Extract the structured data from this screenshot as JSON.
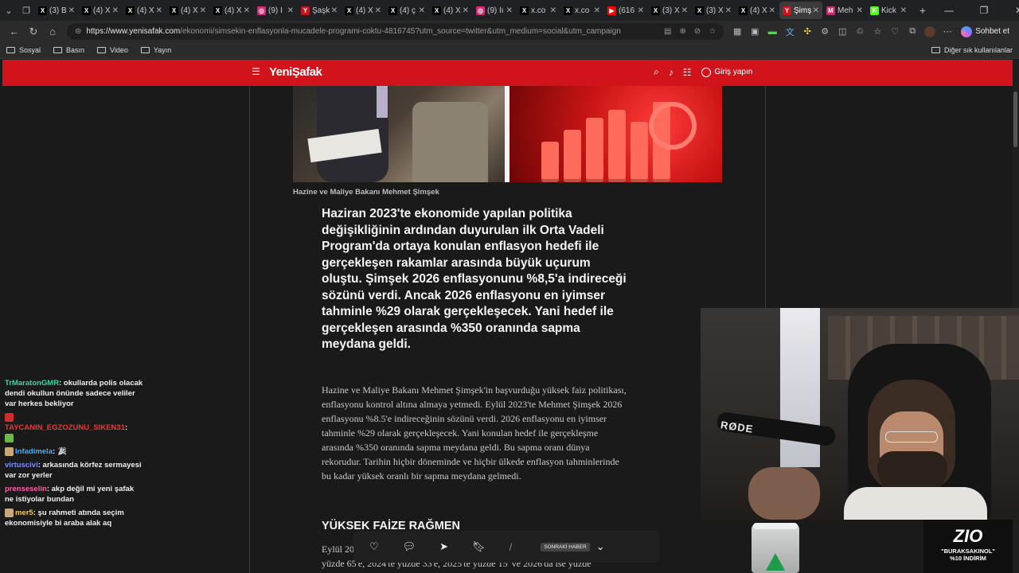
{
  "tabs": [
    {
      "icon": "x-logo-icon",
      "title": "(3) B",
      "fav_color": "#000000",
      "fav_text": "X"
    },
    {
      "icon": "x-logo-icon",
      "title": "(4) X",
      "fav_color": "#000000",
      "fav_text": "X"
    },
    {
      "icon": "x-logo-icon",
      "title": "(4) X",
      "fav_color": "#000000",
      "fav_text": "X"
    },
    {
      "icon": "x-logo-icon",
      "title": "(4) X",
      "fav_color": "#000000",
      "fav_text": "X"
    },
    {
      "icon": "x-logo-icon",
      "title": "(4) X",
      "fav_color": "#000000",
      "fav_text": "X"
    },
    {
      "icon": "instagram-icon",
      "title": "(9) İ",
      "fav_color": "#d62976",
      "fav_text": "◎"
    },
    {
      "icon": "site-icon",
      "title": "Şaşk",
      "fav_color": "#c4161c",
      "fav_text": "Y"
    },
    {
      "icon": "x-logo-icon",
      "title": "(4) X",
      "fav_color": "#000000",
      "fav_text": "X"
    },
    {
      "icon": "x-logo-icon",
      "title": "(4) ç",
      "fav_color": "#000000",
      "fav_text": "X"
    },
    {
      "icon": "x-logo-icon",
      "title": "(4) X",
      "fav_color": "#000000",
      "fav_text": "X"
    },
    {
      "icon": "instagram-icon",
      "title": "(9) İı",
      "fav_color": "#d62976",
      "fav_text": "◎"
    },
    {
      "icon": "x-logo-icon",
      "title": "x.co",
      "fav_color": "#000000",
      "fav_text": "X"
    },
    {
      "icon": "x-logo-icon",
      "title": "x.co",
      "fav_color": "#000000",
      "fav_text": "X"
    },
    {
      "icon": "youtube-icon",
      "title": "(616",
      "fav_color": "#ff0000",
      "fav_text": "▶"
    },
    {
      "icon": "x-logo-icon",
      "title": "(3) X",
      "fav_color": "#000000",
      "fav_text": "X"
    },
    {
      "icon": "x-logo-icon",
      "title": "(3) X",
      "fav_color": "#000000",
      "fav_text": "X"
    },
    {
      "icon": "x-logo-icon",
      "title": "(4) X",
      "fav_color": "#000000",
      "fav_text": "X"
    },
    {
      "icon": "yenisafak-icon",
      "title": "Şimş",
      "fav_color": "#d1141c",
      "fav_text": "Y",
      "active": true
    },
    {
      "icon": "site-icon",
      "title": "Meh",
      "fav_color": "#c0306a",
      "fav_text": "M"
    },
    {
      "icon": "kick-icon",
      "title": "Kick",
      "fav_color": "#53fc18",
      "fav_text": "K"
    }
  ],
  "browser": {
    "url_host": "https://www.yenisafak.com",
    "url_path": "/ekonomi/simsekin-enflasyonla-mucadele-programi-coktu-4816745?utm_source=twitter&utm_medium=social&utm_campaign",
    "copilot_label": "Sohbet et"
  },
  "bookmarks": {
    "items": [
      "Sosyal",
      "Basın",
      "Video",
      "Yayın"
    ],
    "other": "Diğer sık kullanılanlar"
  },
  "site": {
    "logo": "YeniŞafak",
    "login": "Giriş yapın"
  },
  "article": {
    "caption": "Hazine ve Maliye Bakanı Mehmet Şimşek",
    "lead": "Haziran 2023'te ekonomide yapılan politika değişikliğinin ardından duyurulan ilk Orta Vadeli Program'da ortaya konulan enflasyon hedefi ile gerçekleşen rakamlar arasında büyük uçurum oluştu. Şimşek 2026 enflasyonunu %8,5'a indireceği sözünü verdi. Ancak 2026 enflasyonu en iyimser tahminle %29 olarak gerçekleşecek. Yani hedef ile gerçekleşen arasında %350 oranında sapma meydana geldi.",
    "body": "Hazine ve Maliye Bakanı Mehmet Şimşek'in başvurduğu yüksek faiz politikası, enflasyonu kontrol altına almaya yetmedi. Eylül 2023'te Mehmet Şimşek 2026 enflasyonu %8.5'e indireceğinin sözünü verdi. 2026 enflasyonu en iyimser tahminle %29 olarak gerçekleşecek. Yani konulan hedef ile gerçekleşme arasında %350 oranında sapma meydana geldi. Bu sapma oranı dünya rekorudur. Tarihin hiçbir döneminde ve hiçbir ülkede enflasyon tahminlerinde bu kadar yüksek oranlı bir sapma meydana gelmedi.",
    "subhead": "YÜKSEK FAİZE RAĞMEN",
    "body2_line1": "Eylül 20",
    "body2_line2": "yüzde 65'e, 2024'te yüzde 33'e, 2025'te yüzde 15' ve 2026'da ise yüzde"
  },
  "actionbar": {
    "next_label": "SONRAKİ HABER"
  },
  "chat": [
    {
      "user": "TrMaratonGMR",
      "color": "#3fd6a3",
      "text": "okullarda polis olacak dendi okullun önünde sadece veliler var herkes bekliyor"
    },
    {
      "user": "TAYCANIN_EGZOZUNU_SIKEN31",
      "color": "#e33b3b",
      "text": ""
    },
    {
      "user": "Infadimela",
      "color": "#3ab0ff",
      "text": ""
    },
    {
      "user": "virtuscivi",
      "color": "#7c8cff",
      "text": "arkasında körfez sermayesi var zor yerler"
    },
    {
      "user": "prenseselin",
      "color": "#ff5ea8",
      "text": "akp değil mi yeni şafak ne istiyolar bundan"
    },
    {
      "user": "mer5",
      "color": "#f2c94c",
      "text": "şu rahmeti atında seçim ekonomisiyle bi araba alak aq"
    }
  ],
  "webcam": {
    "mic_label": "RØDE"
  },
  "promo": {
    "brand": "ZIO",
    "code": "\"BURAKSAKINOL\"",
    "discount": "%10 İNDİRİM"
  },
  "colors": {
    "site_red": "#d1141c",
    "page_bg": "#1a1a1a"
  }
}
